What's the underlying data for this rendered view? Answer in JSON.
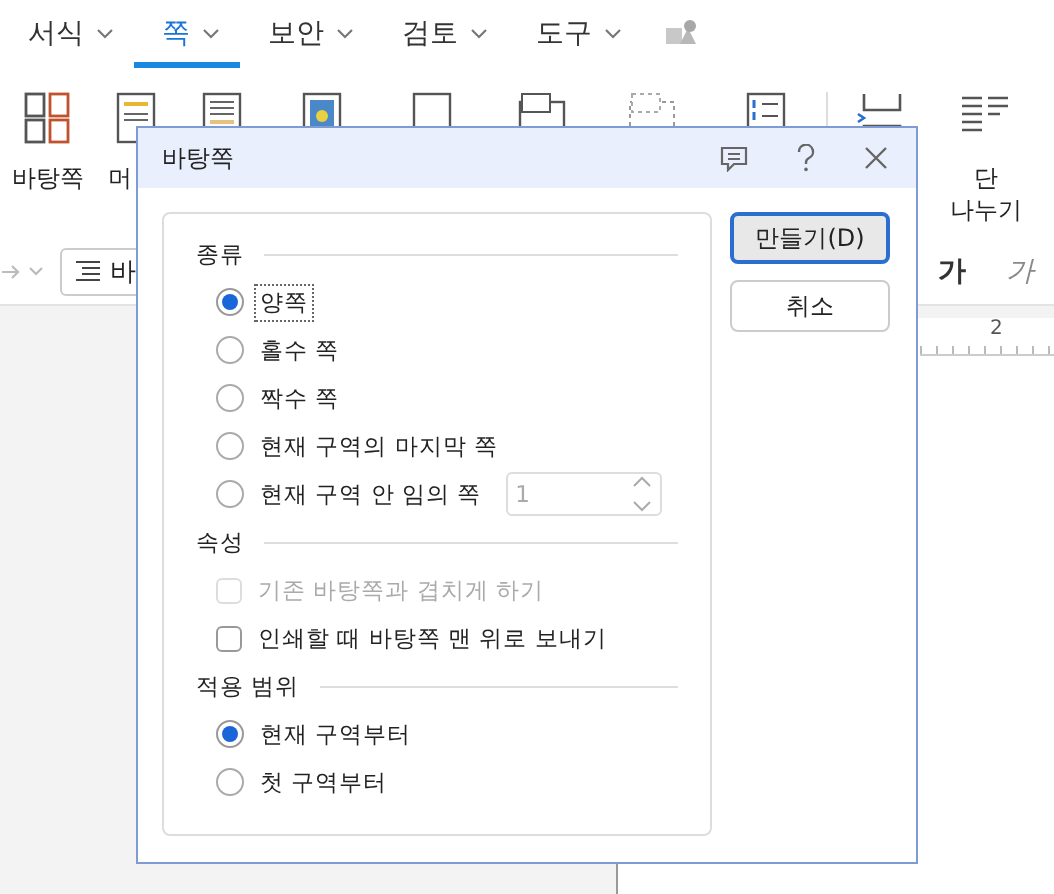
{
  "app": {
    "tabs": [
      {
        "label": "서식",
        "selected": false
      },
      {
        "label": "쪽",
        "selected": true
      },
      {
        "label": "보안",
        "selected": false
      },
      {
        "label": "검토",
        "selected": false
      },
      {
        "label": "도구",
        "selected": false
      }
    ],
    "ribbon": [
      {
        "kind": "master",
        "label": "바탕쪽"
      },
      {
        "kind": "header",
        "label": "머"
      },
      {
        "kind": "footer"
      },
      {
        "kind": "picture"
      },
      {
        "kind": "pagenum"
      },
      {
        "kind": "num3"
      },
      {
        "kind": "num3dash"
      },
      {
        "kind": "numlist"
      },
      {
        "kind": "pagebreak"
      },
      {
        "kind": "colbreak",
        "label": "단\n나누기"
      }
    ],
    "style_box": "바",
    "format_buttons": [
      {
        "kind": "bold",
        "label": "가"
      },
      {
        "kind": "italic",
        "label": "가"
      }
    ],
    "ruler_label": "2"
  },
  "dialog": {
    "title": "바탕쪽",
    "sections": [
      {
        "title": "종류",
        "items": [
          {
            "kind": "radio",
            "label": "양쪽",
            "selected": true,
            "focused": true
          },
          {
            "kind": "radio",
            "label": "홀수 쪽",
            "selected": false,
            "focused": false
          },
          {
            "kind": "radio",
            "label": "짝수 쪽",
            "selected": false,
            "focused": false
          },
          {
            "kind": "radio",
            "label": "현재 구역의 마지막 쪽",
            "selected": false,
            "focused": false
          },
          {
            "kind": "radio_spin",
            "label": "현재 구역 안 임의 쪽",
            "selected": false,
            "focused": false,
            "value": "1",
            "disabled": true
          }
        ]
      },
      {
        "title": "속성",
        "items": [
          {
            "kind": "checkbox",
            "label": "기존 바탕쪽과 겹치게 하기",
            "checked": false,
            "disabled": true
          },
          {
            "kind": "checkbox",
            "label": "인쇄할 때 바탕쪽 맨 위로 보내기",
            "checked": false,
            "disabled": false
          }
        ]
      },
      {
        "title": "적용 범위",
        "items": [
          {
            "kind": "radio",
            "label": "현재 구역부터",
            "selected": true,
            "focused": false
          },
          {
            "kind": "radio",
            "label": "첫 구역부터",
            "selected": false,
            "focused": false
          }
        ]
      }
    ],
    "buttons": [
      {
        "label": "만들기(D)",
        "default": true
      },
      {
        "label": "취소",
        "default": false
      }
    ]
  }
}
